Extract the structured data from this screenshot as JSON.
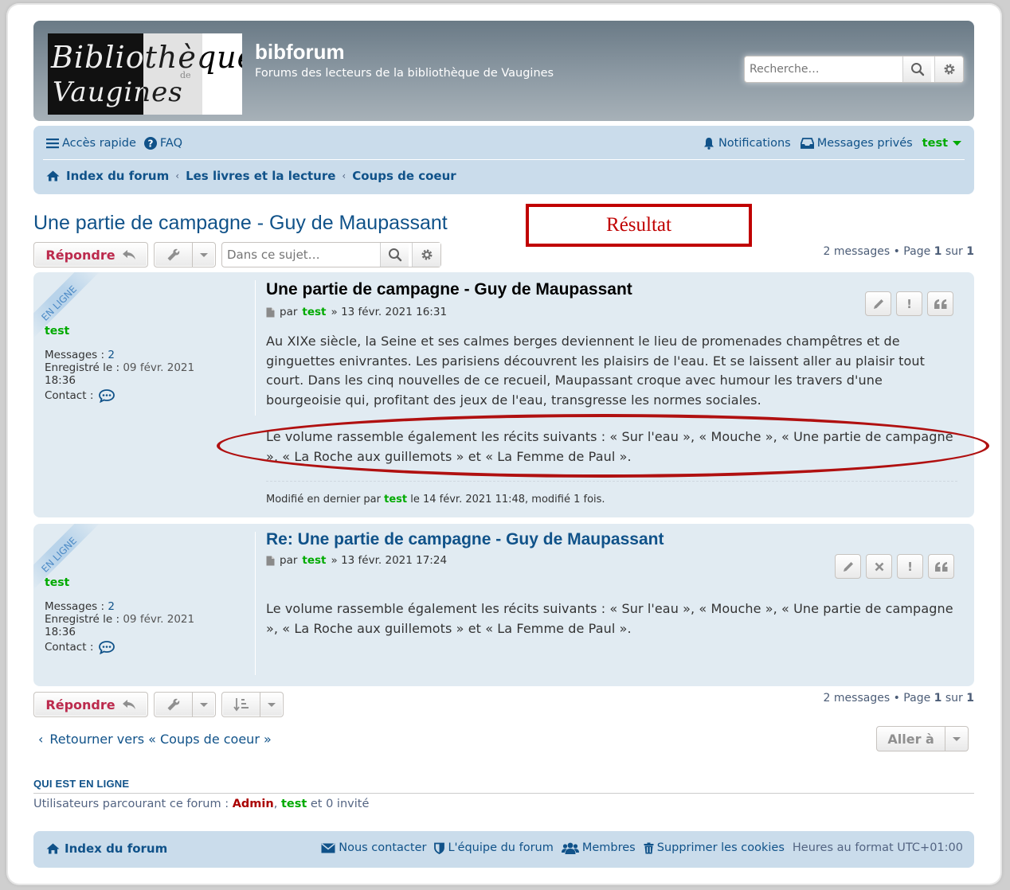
{
  "header": {
    "logo_line1": "Bibliothèque",
    "logo_line2": "Vaugines",
    "logo_de": "de",
    "site_title": "bibforum",
    "site_desc": "Forums des lecteurs de la bibliothèque de Vaugines",
    "search_placeholder": "Recherche…"
  },
  "navbar": {
    "quick_access": "Accès rapide",
    "faq": "FAQ",
    "notifications": "Notifications",
    "private_messages": "Messages privés",
    "username": "test",
    "breadcrumbs": [
      "Index du forum",
      "Les livres et la lecture",
      "Coups de coeur"
    ]
  },
  "topic": {
    "title": "Une partie de campagne - Guy de Maupassant",
    "reply_label": "Répondre",
    "search_placeholder": "Dans ce sujet…",
    "pagination_count": "2 messages",
    "pagination_bullet": "•",
    "pagination_page": "Page",
    "pagination_current": "1",
    "pagination_of": "sur",
    "pagination_total": "1"
  },
  "annotation": {
    "result_label": "Résultat"
  },
  "posts": [
    {
      "online_label": "EN LIGNE",
      "author": "test",
      "messages_label": "Messages :",
      "messages_value": "2",
      "registered_label": "Enregistré le :",
      "registered_value": "09 févr. 2021",
      "registered_time": "18:36",
      "contact_label": "Contact :",
      "title": "Une partie de campagne - Guy de Maupassant",
      "by_label": "par",
      "by_user": "test",
      "date": "» 13 févr. 2021 16:31",
      "paragraph1": "Au XIXe siècle, la Seine et ses calmes berges deviennent le lieu de promenades champêtres et de ginguettes enivrantes. Les parisiens découvrent les plaisirs de l'eau. Et se laissent aller au plaisir tout court. Dans les cinq nouvelles de ce recueil, Maupassant croque avec humour les travers d'une bourgeoisie qui, profitant des jeux de l'eau, transgresse les normes sociales.",
      "paragraph2": "Le volume rassemble également les récits suivants : « Sur l'eau », « Mouche », « Une partie de campagne », « La Roche aux guillemots » et « La Femme de Paul ».",
      "edit_prefix": "Modifié en dernier par",
      "edit_user": "test",
      "edit_suffix": "le 14 févr. 2021 11:48, modifié 1 fois."
    },
    {
      "online_label": "EN LIGNE",
      "author": "test",
      "messages_label": "Messages :",
      "messages_value": "2",
      "registered_label": "Enregistré le :",
      "registered_value": "09 févr. 2021",
      "registered_time": "18:36",
      "contact_label": "Contact :",
      "title": "Re: Une partie de campagne - Guy de Maupassant",
      "by_label": "par",
      "by_user": "test",
      "date": "» 13 févr. 2021 17:24",
      "paragraph1": "Le volume rassemble également les récits suivants : « Sur l'eau », « Mouche », « Une partie de campagne », « La Roche aux guillemots » et « La Femme de Paul »."
    }
  ],
  "bottom": {
    "back_link": "Retourner vers « Coups de coeur »",
    "jump_label": "Aller à",
    "who_title": "QUI EST EN LIGNE",
    "who_prefix": "Utilisateurs parcourant ce forum :",
    "who_admin": "Admin",
    "who_sep": ",",
    "who_test": "test",
    "who_suffix": "et 0 invité"
  },
  "footer": {
    "index": "Index du forum",
    "contact": "Nous contacter",
    "team": "L'équipe du forum",
    "members": "Membres",
    "cookies": "Supprimer les cookies",
    "timezone": "Heures au format UTC+01:00"
  },
  "colors": {
    "link": "#105289",
    "reply_button_text": "#bc2a4d",
    "username_green": "#00aa00",
    "admin_red": "#aa0000",
    "annotation_red": "#c00000",
    "post_bg": "#e1ebf2",
    "navbar_bg": "#cadceb"
  }
}
